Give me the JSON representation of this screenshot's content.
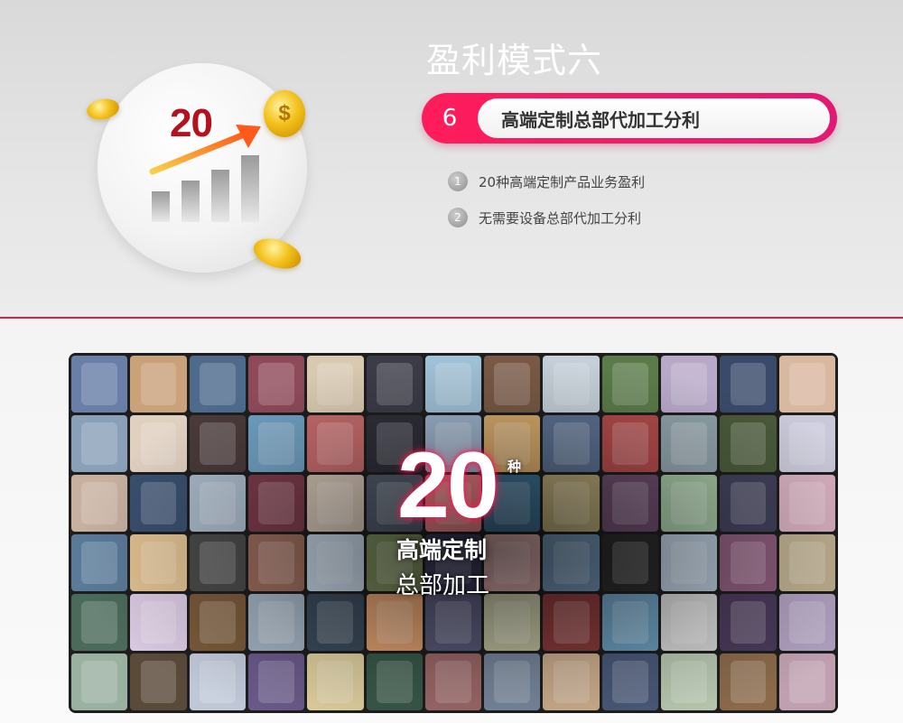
{
  "header": {
    "title": "盈利模式六",
    "tag": {
      "number": "6",
      "label": "高端定制总部代加工分利"
    },
    "points": [
      {
        "index": "1",
        "text": "20种高端定制产品业务盈利"
      },
      {
        "index": "2",
        "text": "无需要设备总部代加工分利"
      }
    ]
  },
  "illustration": {
    "number": "20",
    "icons": [
      "gold-coin-icon",
      "growth-arrow-icon",
      "bar-chart-icon",
      "dollar-coin-icon"
    ]
  },
  "collage": {
    "number": "20",
    "unit": "种",
    "caption_line1": "高端定制",
    "caption_line2": "总部加工",
    "tile_colors": [
      "#6a7fa8",
      "#c9a27a",
      "#4e6b8c",
      "#8f4a5a",
      "#d8c9b0",
      "#3c3c48",
      "#a1c2d8",
      "#7a5a46",
      "#c5d0d9",
      "#5b7c4a",
      "#b8a9c9",
      "#3a4a6a",
      "#d9b8a0",
      "#8aa0b8",
      "#e0d0c0",
      "#4a3a3a",
      "#6f9fc0",
      "#c46a6a",
      "#2f2f3a",
      "#9ab0c8",
      "#d4a86a",
      "#5a6f8f",
      "#b04a4a",
      "#8fa0a8",
      "#4a5a3a",
      "#c9c9d9",
      "#c8b0a0",
      "#3a5070",
      "#a8b8c8",
      "#7a3a4a",
      "#d0c0b0",
      "#505a6a",
      "#e08080",
      "#3a6a8a",
      "#b0a070",
      "#6a4a6a",
      "#a0c0a0",
      "#40405a",
      "#d8b0c0",
      "#5a7a9a",
      "#e0c090",
      "#4a4a4a",
      "#9a6a5a",
      "#c0d0e0",
      "#7a8a5a",
      "#3a3a5a",
      "#d0a0a0",
      "#6a8aaa",
      "#2a2a2a",
      "#b0c0d0",
      "#8a5a7a",
      "#c0b090",
      "#4a6a5a",
      "#d8c8e0",
      "#7a5a3a",
      "#a0b0c0",
      "#3a4a5a",
      "#e0a070",
      "#5a5a7a",
      "#c0c0a0",
      "#8a3a3a",
      "#6a9aba",
      "#d0d0d0",
      "#4a3a5a",
      "#b0a0c0",
      "#9ab0a0",
      "#5a4a3a",
      "#c0c8d8",
      "#6a5a8a",
      "#e0d0a0",
      "#3a5a4a",
      "#a06a6a",
      "#7a8aa0",
      "#d0b090",
      "#4a5a7a",
      "#b8c8b0",
      "#8a6a4a",
      "#c0a0b0"
    ]
  }
}
